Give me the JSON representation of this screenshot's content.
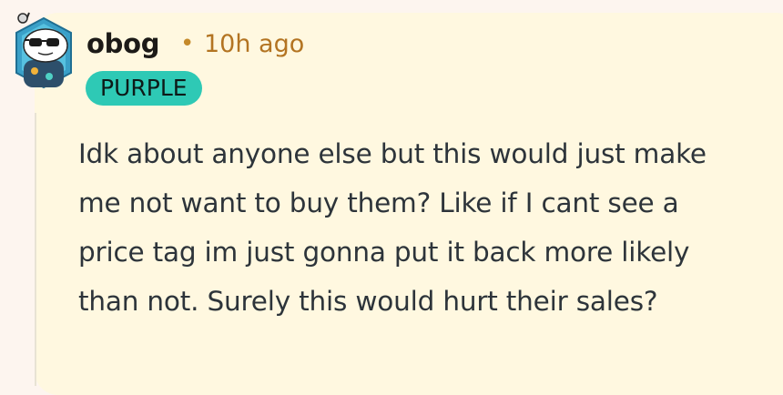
{
  "comment": {
    "author": "obog",
    "separator": "•",
    "timestamp": "10h ago",
    "flair": "PURPLE",
    "body": "Idk about anyone else but this would just make me not want to buy them? Like if I cant see a price tag im just gonna put it back more likely than not. Surely this would hurt their sales?"
  },
  "colors": {
    "page_background": "#fdf5ef",
    "card_background": "#fff8e0",
    "timestamp": "#b37422",
    "flair_background": "#2ec9b5",
    "body_text": "#2d343a"
  },
  "icons": {
    "avatar": "snoo-avatar-with-sunglasses-icon"
  }
}
